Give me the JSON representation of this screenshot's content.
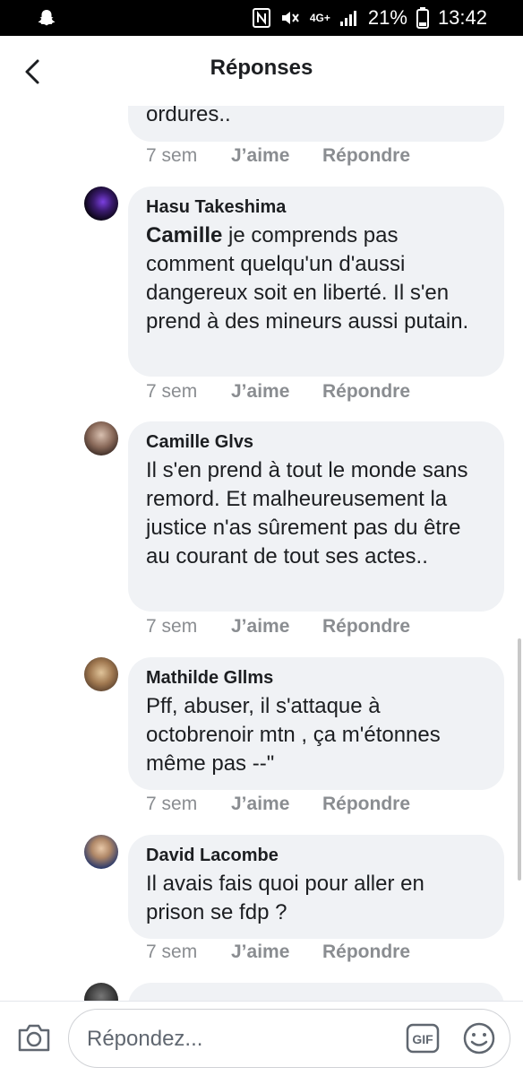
{
  "status_bar": {
    "battery": "21%",
    "time": "13:42",
    "network": "4G+"
  },
  "header": {
    "title": "Réponses",
    "back_icon": "chevron-left-icon"
  },
  "comments": [
    {
      "author": "",
      "text": "ordures..",
      "time": "7 sem",
      "like_label": "J’aime",
      "reply_label": "Répondre"
    },
    {
      "author": "Hasu Takeshima",
      "mention": "Camille",
      "text": "je comprends pas comment quelqu'un d'aussi dangereux soit en liberté. Il s'en prend à des mineurs aussi putain.",
      "time": "7 sem",
      "like_label": "J’aime",
      "reply_label": "Répondre"
    },
    {
      "author": "Camille Glvs",
      "text": "Il s'en prend à tout le monde sans remord. Et malheureusement la justice n'as sûrement pas du être au courant de tout ses actes..",
      "time": "7 sem",
      "like_label": "J’aime",
      "reply_label": "Répondre"
    },
    {
      "author": "Mathilde Gllms",
      "text": "Pff, abuser, il s'attaque à octobrenoir mtn , ça m'étonnes même pas --\"",
      "time": "7 sem",
      "like_label": "J’aime",
      "reply_label": "Répondre"
    },
    {
      "author": "David Lacombe",
      "text": "Il avais fais quoi pour aller en prison se fdp ?",
      "time": "7 sem",
      "like_label": "J’aime",
      "reply_label": "Répondre"
    }
  ],
  "composer": {
    "placeholder": "Répondez...",
    "gif_label": "GIF"
  },
  "colors": {
    "bubble": "#f0f2f5",
    "text": "#1c1e21",
    "meta": "#8a8d91"
  }
}
